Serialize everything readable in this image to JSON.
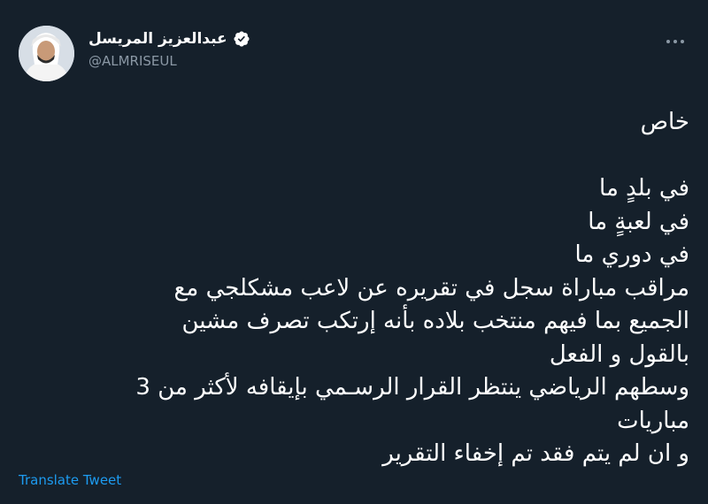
{
  "tweet": {
    "author": {
      "display_name": "عبدالعزيز المريسل",
      "handle": "@ALMRISEUL",
      "verified": true
    },
    "lines": [
      "خاص",
      "",
      "في بلدٍ ما",
      "في لعبةٍ ما",
      "في دوري ما",
      "مراقب مباراة سجل في تقريره عن لاعب مشكلجي مع",
      "الجميع بما فيهم منتخب بلاده بأنه إرتكب تصرف مشين",
      "بالقول و الفعل",
      "وسطهم الرياضي ينتظر القرار الرسـمي بإيقافه لأكثر من 3",
      "مباريات",
      "و ان لم يتم فقد تم إخفاء التقرير"
    ],
    "translate_label": "Translate Tweet"
  },
  "colors": {
    "background": "#15202b",
    "text": "#ffffff",
    "secondary_text": "#8b98a5",
    "accent": "#1d9bf0"
  }
}
